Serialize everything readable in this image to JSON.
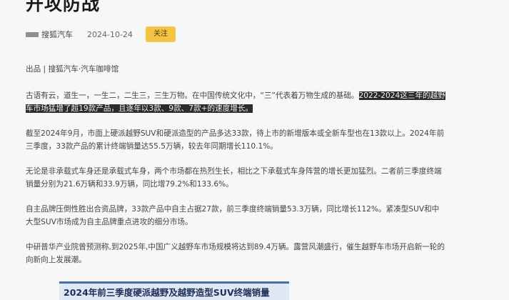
{
  "article": {
    "title": "开攻防战",
    "author": "搜狐汽车",
    "date": "2024-10-24",
    "follow_label": "关注",
    "source_line": "出品 | 搜狐汽车·汽车咖啡馆",
    "p1_plain": "古语有云，道生一，一生二，二生三，三生万物。在中国传统文化中，“三”代表着万物生成的基础。",
    "p1_highlight": "2022-2024这三年的越野车市场猛增了超19款产品，且逐年以3款、9款、7款+的速度增长。",
    "p2": "截至2024年9月，市面上硬派越野SUV和硬派造型的产品多达33款，待上市的新增版本或全新车型也在13款以上。2024年前三季度，33款产品的累计终端销量达55.5万辆，较去年同期增长110.1%。",
    "p3": "无论是非承载式车身还是承载式车身，两个市场都在热烈生长，相比之下承载式车身阵营的增长更加猛烈。二者前三季度终端销量分别为21.6万辆和33.9万辆，同比增79.2%和133.6%。",
    "p4": "自主品牌压倒性胜出合资品牌，33款产品中自主占据27款，前三季度终端销量53.3万辆，同比增长112%。紧凑型SUV和中大型SUV市场成为自主品牌重点进攻的细分市场。",
    "p5": "中研普华产业院曾预测称,到2025年,中国广义越野车市场规模将达到89.4万辆。露营风潮盛行，催生越野车市场开启新一轮的向新向上发展潮。",
    "figure_title": "2024年前三季度硬派越野及越野造型SUV终端销量"
  }
}
